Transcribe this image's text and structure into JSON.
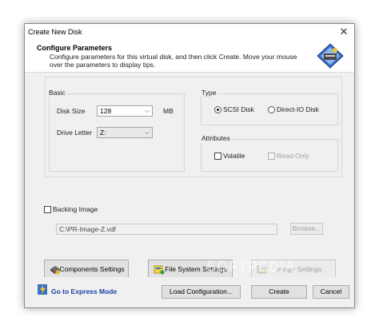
{
  "window": {
    "title": "Create New Disk"
  },
  "header": {
    "title": "Configure Parameters",
    "description": "Configure parameters for this virtual disk, and then click Create. Move your mouse over the parameters to display tips."
  },
  "basic": {
    "label": "Basic",
    "disk_size_label": "Disk Size",
    "disk_size_value": "128",
    "disk_size_unit": "MB",
    "drive_letter_label": "Drive Letter",
    "drive_letter_value": "Z:"
  },
  "type": {
    "label": "Type",
    "scsi_label": "SCSI Disk",
    "directio_label": "Direct-IO Disk",
    "selected": "scsi"
  },
  "attributes": {
    "label": "Attributes",
    "volatile_label": "Volatile",
    "volatile_checked": false,
    "readonly_label": "Read-Only",
    "readonly_checked": false
  },
  "backing": {
    "label": "Backing Image",
    "checked": false,
    "path": "C:\\PR-Image-Z.vdf",
    "browse_label": "Browse..."
  },
  "buttons": {
    "components": "Components Settings",
    "filesystem": "File System Settings",
    "image": "Image Settings"
  },
  "footer": {
    "express": "Go to Express Mode",
    "load": "Load Configuration...",
    "create": "Create",
    "cancel": "Cancel"
  },
  "watermark": "SOFTPEDIA"
}
